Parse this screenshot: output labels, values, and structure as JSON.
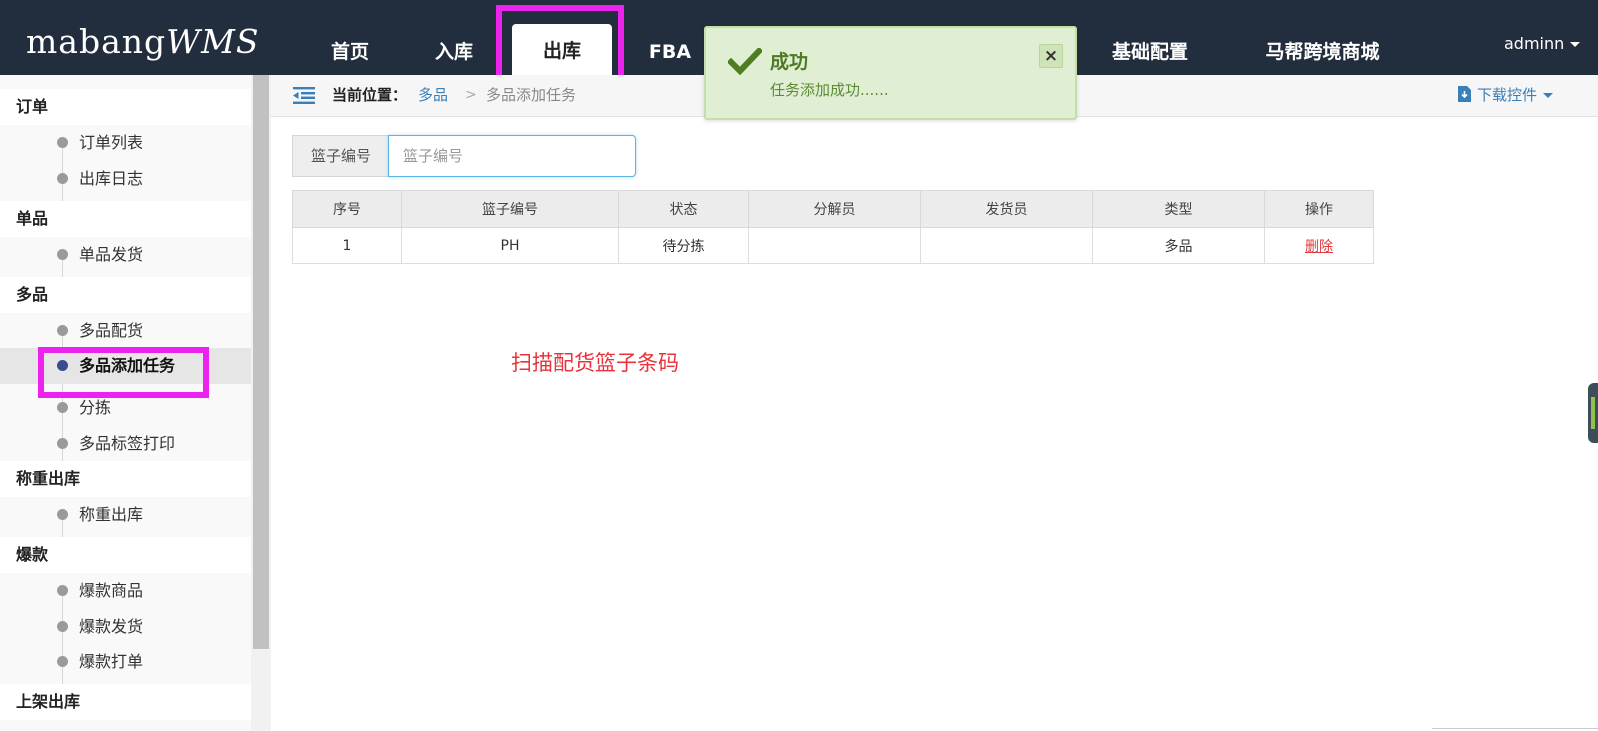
{
  "header": {
    "logo_main": "mabang",
    "logo_accent": "WMS",
    "nav": [
      "首页",
      "入库",
      "出库",
      "FBA",
      "基础配置",
      "马帮跨境商城"
    ],
    "active_nav": "出库",
    "user": "adminn"
  },
  "sidebar": {
    "groups": {
      "order": "订单",
      "single": "单品",
      "multi": "多品",
      "weigh": "称重出库",
      "hot": "爆款",
      "shelf": "上架出库"
    },
    "items": {
      "order_list": "订单列表",
      "outbound_log": "出库日志",
      "single_ship": "单品发货",
      "multi_allocate": "多品配货",
      "multi_add_task": "多品添加任务",
      "sorting": "分拣",
      "multi_label_print": "多品标签打印",
      "weigh_outbound": "称重出库",
      "hot_goods": "爆款商品",
      "hot_ship": "爆款发货",
      "hot_print": "爆款打单"
    }
  },
  "breadcrumb": {
    "label": "当前位置：",
    "parent": "多品",
    "separator": ">",
    "current": "多品添加任务"
  },
  "toolbar": {
    "download_label": "下载控件"
  },
  "search": {
    "addon": "篮子编号",
    "placeholder": "篮子编号",
    "value": ""
  },
  "table": {
    "headers": [
      "序号",
      "篮子编号",
      "状态",
      "分解员",
      "发货员",
      "类型",
      "操作"
    ],
    "rows": [
      {
        "index": "1",
        "basket": "PH",
        "status": "待分拣",
        "splitter": "",
        "shipper": "",
        "type": "多品",
        "action": "删除"
      }
    ]
  },
  "hint": "扫描配货篮子条码",
  "toast": {
    "title": "成功",
    "message": "任务添加成功......",
    "close": "×"
  },
  "colors": {
    "topbar": "#222d3d",
    "highlight": "#ee22ee",
    "link": "#3a7fb8",
    "danger": "#e0393e",
    "success_bg": "#e0efd3"
  }
}
